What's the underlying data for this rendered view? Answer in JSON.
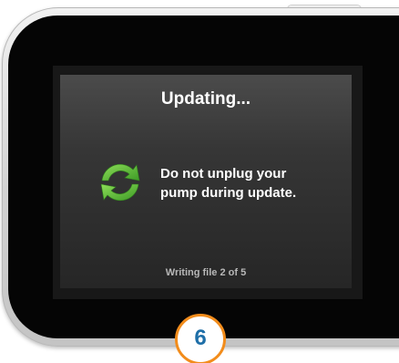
{
  "screen": {
    "title": "Updating...",
    "message_line1": "Do not unplug your",
    "message_line2": "pump during update.",
    "status": "Writing file 2 of 5",
    "icon": "sync-icon"
  },
  "callout": {
    "step_number": "6"
  },
  "colors": {
    "screen_background": "#2b2b2b",
    "icon_green": "#5fbf3a",
    "badge_border": "#f28c1b",
    "badge_text": "#1f6fa8"
  }
}
